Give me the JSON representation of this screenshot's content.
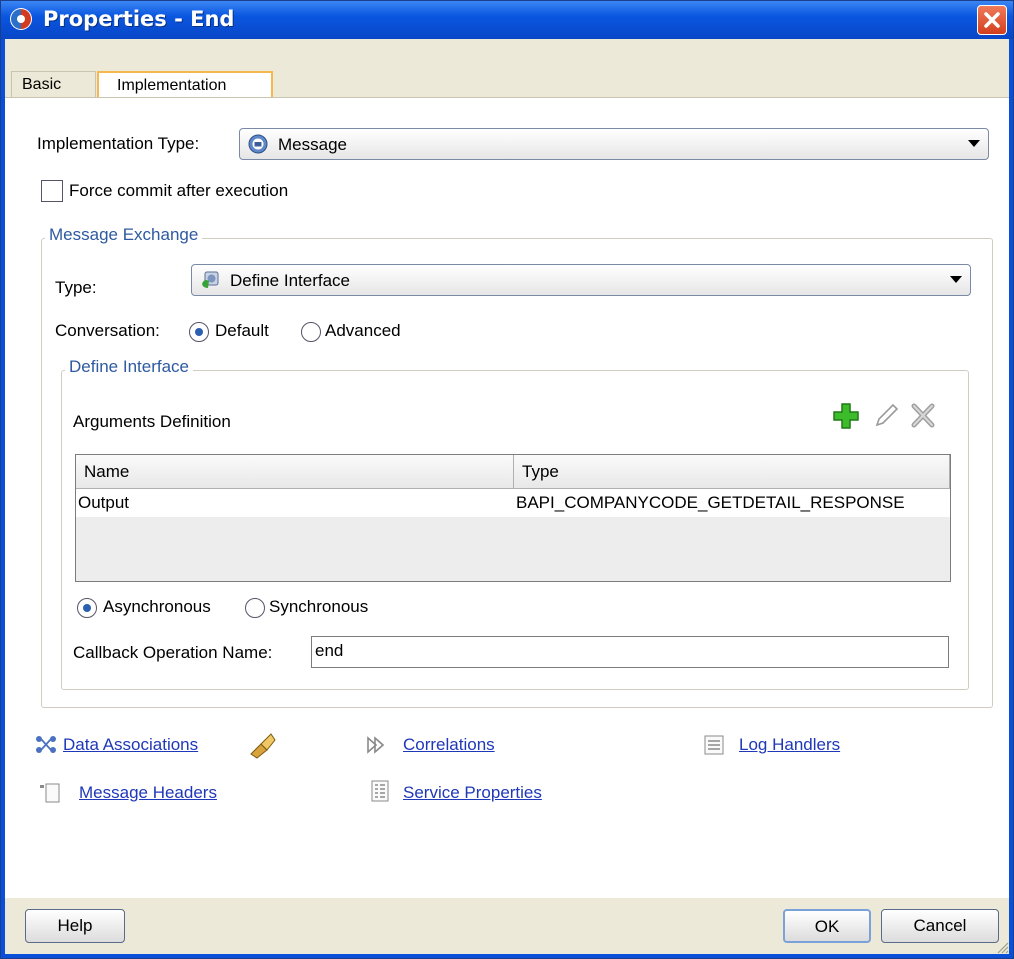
{
  "window": {
    "title": "Properties - End"
  },
  "tabs": [
    {
      "label": "Basic"
    },
    {
      "label": "Implementation"
    }
  ],
  "implementation": {
    "type_label": "Implementation Type:",
    "type_value": "Message",
    "force_commit_label": "Force commit after execution",
    "force_commit_checked": false
  },
  "message_exchange": {
    "title": "Message Exchange",
    "type_label": "Type:",
    "type_value": "Define Interface",
    "conversation_label": "Conversation:",
    "conversation_options": [
      {
        "label": "Default",
        "selected": true
      },
      {
        "label": "Advanced",
        "selected": false
      }
    ]
  },
  "define_interface": {
    "title": "Define Interface",
    "arguments_label": "Arguments Definition",
    "toolbar": {
      "add_icon": "plus-icon",
      "edit_icon": "pencil-icon",
      "delete_icon": "x-icon"
    },
    "columns": [
      "Name",
      "Type"
    ],
    "rows": [
      {
        "name": "Output",
        "type": "BAPI_COMPANYCODE_GETDETAIL_RESPONSE"
      }
    ],
    "mode_options": [
      {
        "label": "Asynchronous",
        "selected": true
      },
      {
        "label": "Synchronous",
        "selected": false
      }
    ],
    "callback_label": "Callback Operation Name:",
    "callback_value": "end"
  },
  "links": {
    "data_associations": "Data Associations",
    "correlations": "Correlations",
    "log_handlers": "Log Handlers",
    "message_headers": "Message Headers",
    "service_properties": "Service Properties"
  },
  "buttons": {
    "help": "Help",
    "ok": "OK",
    "cancel": "Cancel"
  },
  "colors": {
    "titlebar": "#0a56e0",
    "accent_tab": "#f5b84f",
    "link": "#1f38b8",
    "group_title": "#2d5aa0"
  }
}
